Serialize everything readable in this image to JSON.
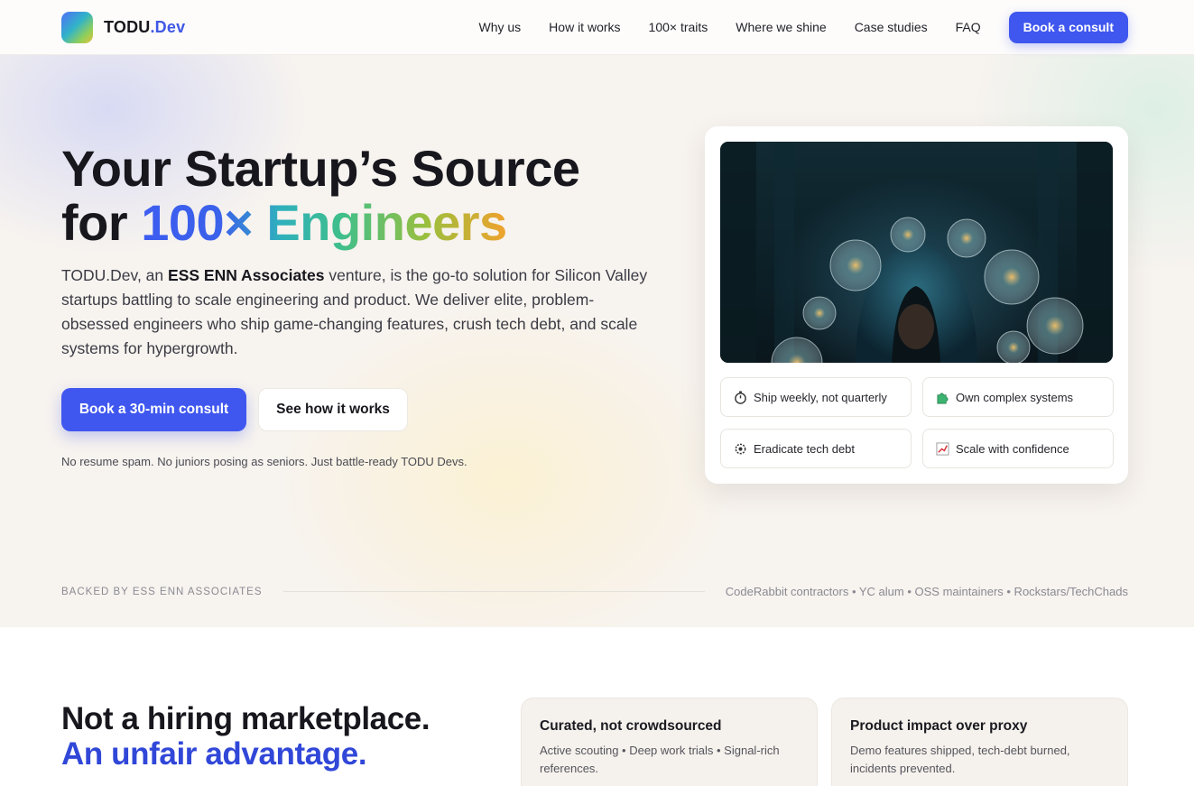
{
  "brand": {
    "name": "TODU",
    "suffix": ".Dev"
  },
  "nav": {
    "items": [
      "Why us",
      "How it works",
      "100× traits",
      "Where we shine",
      "Case studies",
      "FAQ"
    ],
    "cta": "Book a consult"
  },
  "hero": {
    "headline_line1": "Your Startup’s Source",
    "headline_for": "for",
    "headline_grad": "100× Engineers",
    "lede_pre": "TODU.Dev, an",
    "lede_bold": "ESS ENN Associates",
    "lede_post": "venture, is the go-to solution for Silicon Valley startups battling to scale engineering and product. We deliver elite, problem-obsessed engineers who ship game-changing features, crush tech debt, and scale systems for hypergrowth.",
    "primary_cta": "Book a 30-min consult",
    "secondary_cta": "See how it works",
    "note": "No resume spam. No juniors posing as seniors. Just battle-ready TODU Devs."
  },
  "card": {
    "chips": [
      {
        "icon": "stopwatch-icon",
        "label": "Ship weekly, not quarterly"
      },
      {
        "icon": "puzzle-icon",
        "label": "Own complex systems"
      },
      {
        "icon": "gear-icon",
        "label": "Eradicate tech debt"
      },
      {
        "icon": "chart-icon",
        "label": "Scale with confidence"
      }
    ]
  },
  "backed": {
    "label": "Backed by ESS ENN Associates",
    "list": "CodeRabbit contractors • YC alum • OSS maintainers • Rockstars/TechChads"
  },
  "section2": {
    "title_line1": "Not a hiring marketplace.",
    "title_line2": "An unfair advantage.",
    "features": [
      {
        "title": "Curated, not crowdsourced",
        "text": "Active scouting • Deep work trials • Signal-rich references."
      },
      {
        "title": "Product impact over proxy",
        "text": "Demo features shipped, tech-debt burned, incidents prevented."
      }
    ]
  },
  "colors": {
    "accent": "#3f57ef",
    "heading_blue": "#3147d8",
    "hero_bg": "#f7f3ef"
  }
}
